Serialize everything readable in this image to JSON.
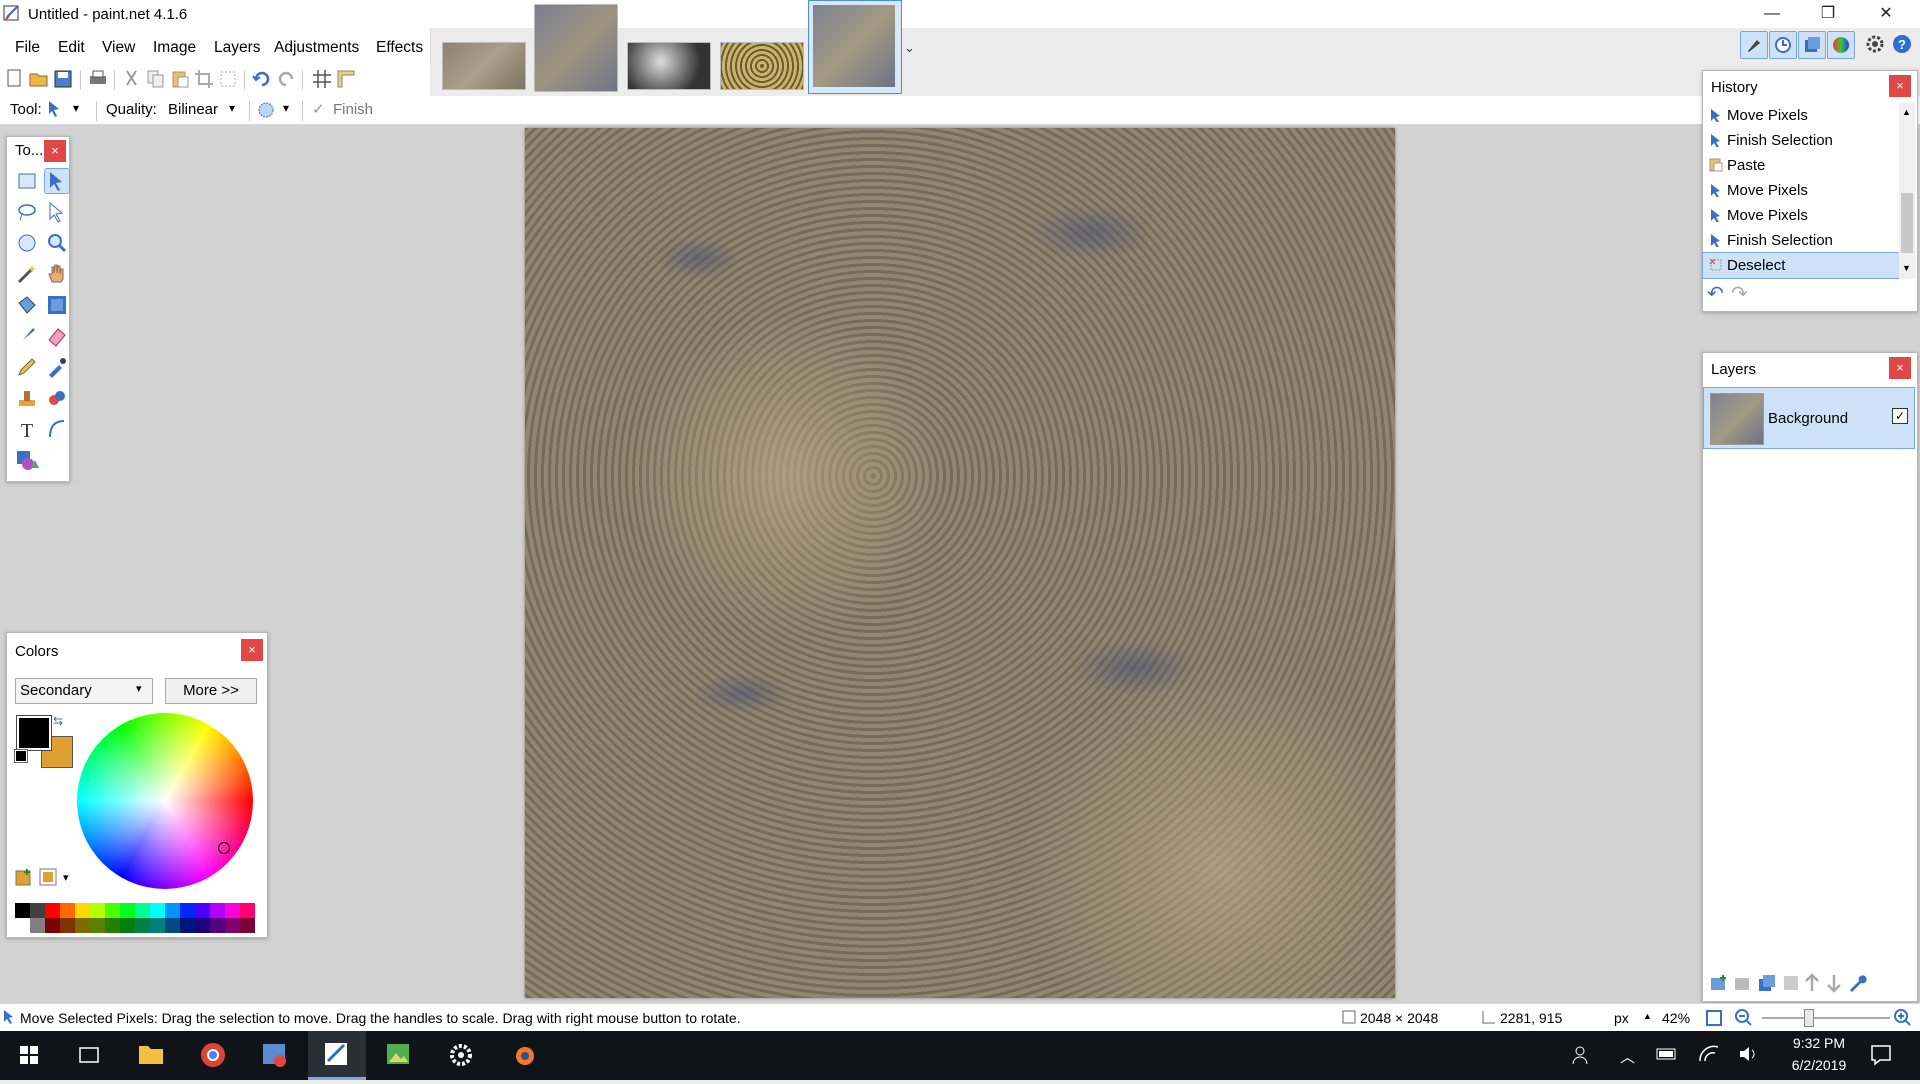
{
  "window": {
    "title": "Untitled - paint.net 4.1.6",
    "minimize_glyph": "—",
    "maximize_glyph": "❐",
    "close_glyph": "✕"
  },
  "menu": {
    "items": [
      "File",
      "Edit",
      "View",
      "Image",
      "Layers",
      "Adjustments",
      "Effects"
    ]
  },
  "image_tabs": {
    "count": 5,
    "selected_index": 4,
    "more_glyph": "⌄"
  },
  "toolbar": {
    "tool_label": "Tool:",
    "quality_label": "Quality:",
    "quality_value": "Bilinear",
    "finish_label": "Finish",
    "finish_glyph": "✓",
    "dropdown_glyph": "▾"
  },
  "tools_panel": {
    "title": "To...",
    "close_glyph": "×",
    "icons": [
      "rectangle-select-icon",
      "move-selected-pixels-icon",
      "lasso-select-icon",
      "move-selection-icon",
      "ellipse-select-icon",
      "zoom-icon",
      "magic-wand-icon",
      "pan-icon",
      "paint-bucket-icon",
      "gradient-icon",
      "paintbrush-icon",
      "eraser-icon",
      "pencil-icon",
      "color-picker-icon",
      "clone-stamp-icon",
      "recolor-icon",
      "text-icon",
      "line-curve-icon",
      "shapes-icon"
    ]
  },
  "colors_panel": {
    "title": "Colors",
    "close_glyph": "×",
    "mode_value": "Secondary",
    "more_label": "More >>",
    "primary_color": "#000000",
    "secondary_color": "#e0a030",
    "palette": [
      "#000000",
      "#404040",
      "#ff0000",
      "#ff6a00",
      "#ffd800",
      "#b6ff00",
      "#4cff00",
      "#00ff21",
      "#00ff90",
      "#00ffff",
      "#0094ff",
      "#0026ff",
      "#4800ff",
      "#b200ff",
      "#ff00dc",
      "#ff006e"
    ],
    "palette_dark": [
      "#ffffff",
      "#808080",
      "#7f0000",
      "#7f3300",
      "#7f6a00",
      "#5b7f00",
      "#267f00",
      "#007f0e",
      "#007f46",
      "#007f7f",
      "#004a7f",
      "#00137f",
      "#21007f",
      "#57007f",
      "#7f006e",
      "#7f0037"
    ]
  },
  "history_panel": {
    "title": "History",
    "close_glyph": "×",
    "items": [
      {
        "label": "Move Pixels",
        "icon": "move-pixels-icon"
      },
      {
        "label": "Finish Selection",
        "icon": "finish-selection-icon"
      },
      {
        "label": "Paste",
        "icon": "paste-icon"
      },
      {
        "label": "Move Pixels",
        "icon": "move-pixels-icon"
      },
      {
        "label": "Move Pixels",
        "icon": "move-pixels-icon"
      },
      {
        "label": "Finish Selection",
        "icon": "finish-selection-icon"
      },
      {
        "label": "Deselect",
        "icon": "deselect-icon"
      }
    ],
    "selected_index": 6,
    "undo_glyph": "↶",
    "redo_glyph": "↷"
  },
  "layers_panel": {
    "title": "Layers",
    "close_glyph": "×",
    "layers": [
      {
        "name": "Background",
        "visible": true
      }
    ],
    "check_glyph": "✓"
  },
  "statusbar": {
    "hint": "Move Selected Pixels: Drag the selection to move. Drag the handles to scale. Drag with right mouse button to rotate.",
    "image_size": "2048 × 2048",
    "cursor_pos": "2281, 915",
    "units": "px",
    "units_glyph": "▲",
    "zoom": "42%",
    "zoom_level_fraction": 0.42
  },
  "taskbar": {
    "time": "9:32 PM",
    "date": "6/2/2019"
  },
  "colors": {
    "accent": "#4f8fd0",
    "close_red": "#e04848",
    "selection": "#cde2f7"
  }
}
